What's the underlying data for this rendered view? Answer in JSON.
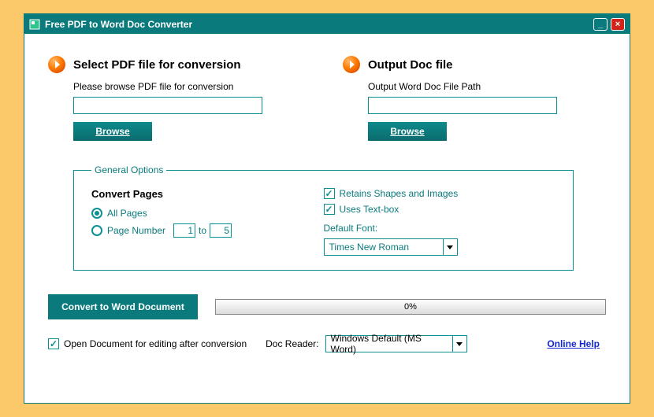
{
  "titlebar": {
    "title": "Free PDF to Word Doc Converter"
  },
  "input": {
    "title": "Select PDF file for conversion",
    "help": "Please browse PDF file for conversion",
    "value": "",
    "browse": "Browse"
  },
  "output": {
    "title": "Output Doc file",
    "help": "Output Word Doc File Path",
    "value": "",
    "browse": "Browse"
  },
  "options": {
    "legend": "General Options",
    "convert_pages": "Convert Pages",
    "all_pages": "All Pages",
    "page_number": "Page Number",
    "to": "to",
    "from_val": "1",
    "to_val": "5",
    "retains": "Retains Shapes and Images",
    "textbox": "Uses Text-box",
    "default_font": "Default Font:",
    "font_value": "Times New Roman"
  },
  "actions": {
    "convert": "Convert to Word Document",
    "progress": "0%",
    "open_after": "Open Document for editing after conversion",
    "doc_reader_label": "Doc Reader:",
    "doc_reader_value": "Windows Default (MS Word)",
    "help_link": "Online Help"
  }
}
